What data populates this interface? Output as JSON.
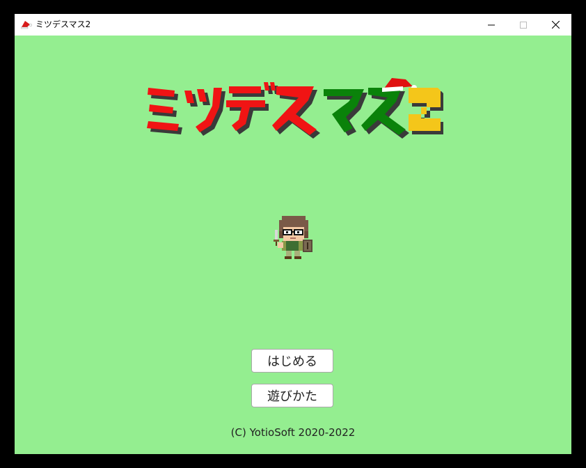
{
  "window": {
    "title": "ミツデスマス2",
    "icon": "santa-hat-icon",
    "controls": [
      "minimize-icon",
      "maximize-icon",
      "close-icon"
    ]
  },
  "logo": {
    "text": "ミツデスマス2",
    "icon": "santa-hat-icon",
    "colors": {
      "red": "#f01414",
      "green": "#0a820a",
      "yellow": "#f4c61a",
      "shadow": "#3a3a3a"
    }
  },
  "menu": {
    "start_label": "はじめる",
    "howto_label": "遊びかた"
  },
  "footer": {
    "copyright": "(C) YotioSoft 2020-2022"
  },
  "colors": {
    "background": "#94ee90",
    "frame": "#000000"
  }
}
